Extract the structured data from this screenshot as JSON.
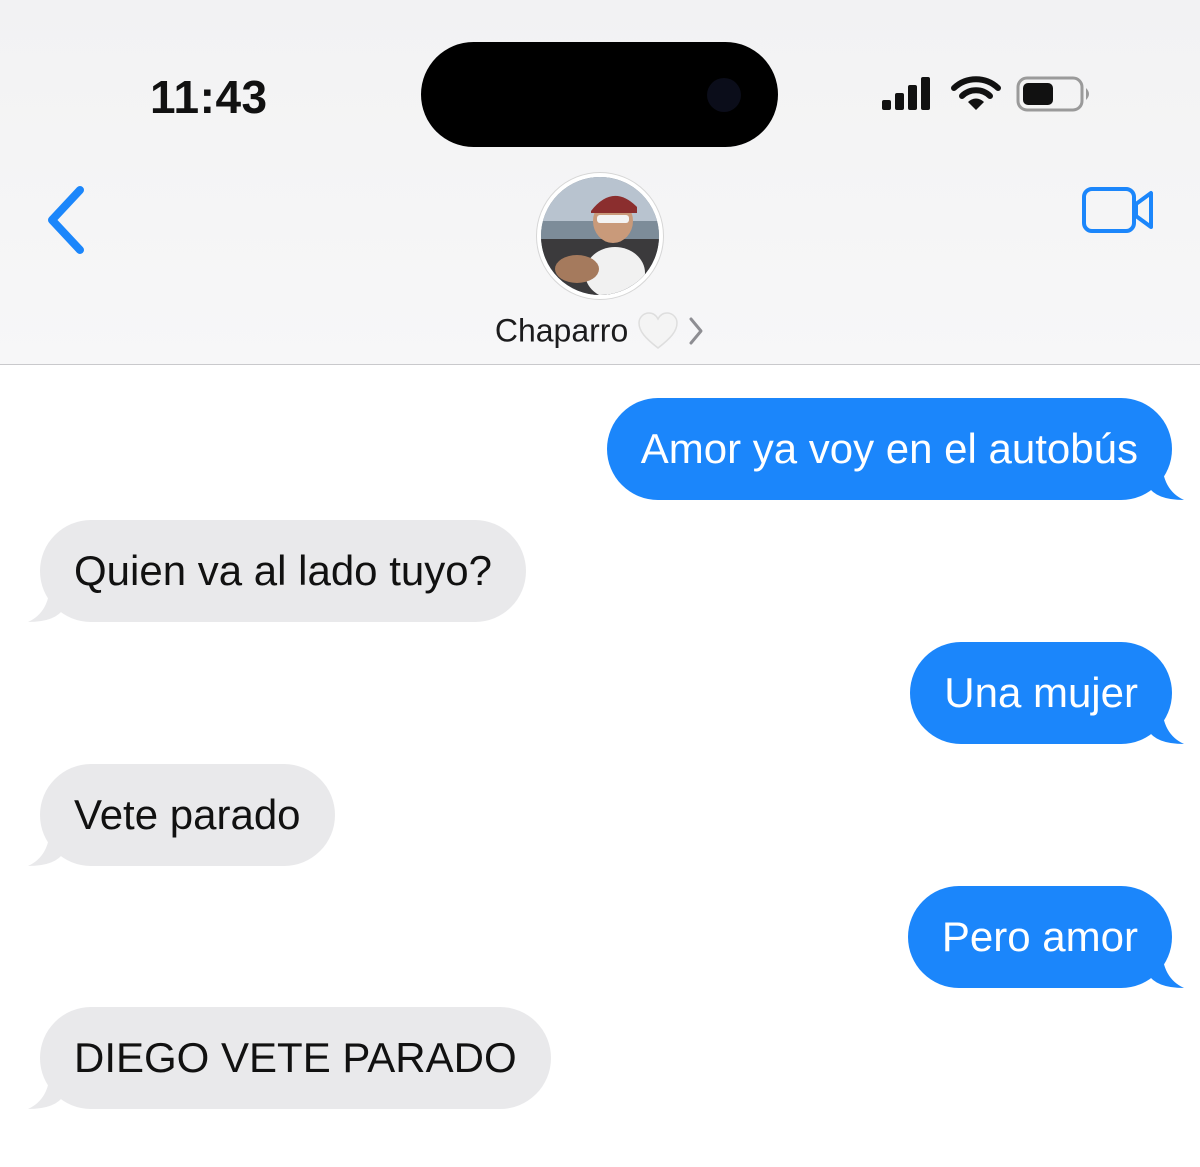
{
  "status_bar": {
    "time": "11:43",
    "icons": [
      "cellular-signal-icon",
      "wifi-icon",
      "battery-icon"
    ],
    "battery_level": 0.55
  },
  "nav": {
    "back_icon": "chevron-left-icon",
    "video_icon": "video-camera-icon",
    "contact_name": "Chaparro",
    "contact_emoji": "🤍",
    "accent_color": "#1b86fb"
  },
  "messages": [
    {
      "direction": "sent",
      "text": "Amor ya voy en el autobús"
    },
    {
      "direction": "received",
      "text": "Quien va al lado tuyo?"
    },
    {
      "direction": "sent",
      "text": "Una mujer"
    },
    {
      "direction": "received",
      "text": "Vete parado"
    },
    {
      "direction": "sent",
      "text": "Pero amor"
    },
    {
      "direction": "received",
      "text": "DIEGO VETE PARADO"
    }
  ],
  "colors": {
    "sent_bubble": "#1b86fb",
    "received_bubble": "#e9e9eb"
  }
}
